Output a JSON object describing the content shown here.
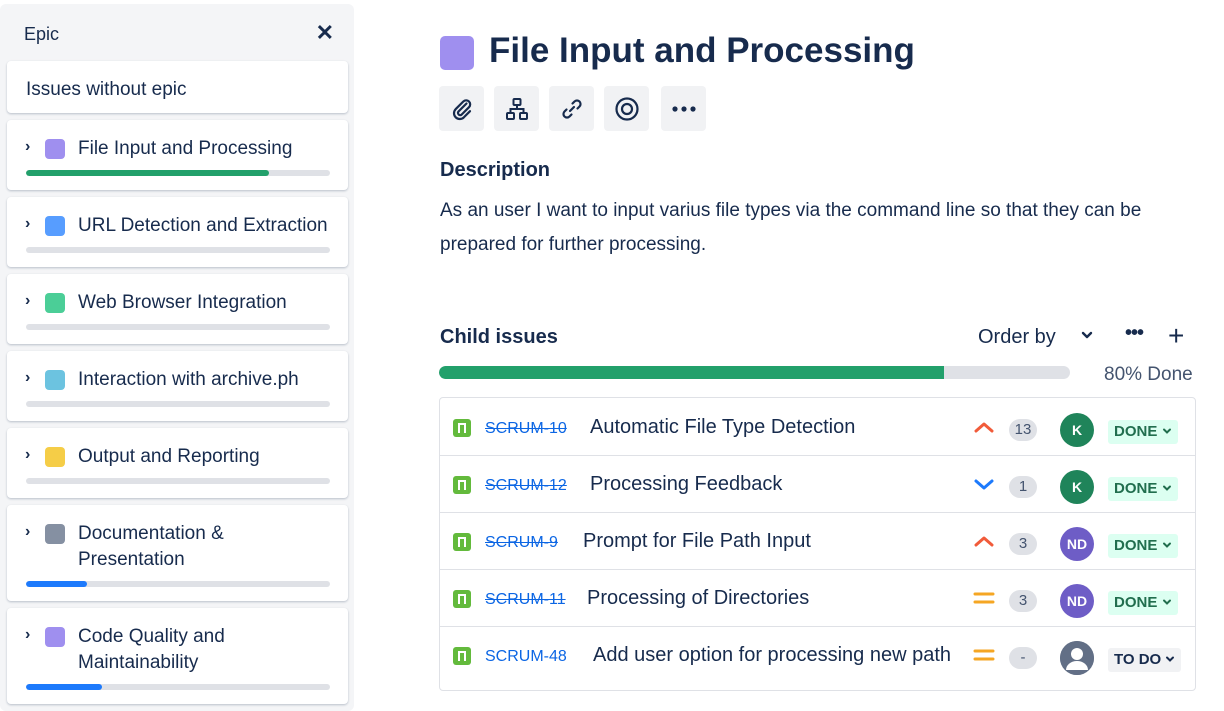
{
  "sidebar": {
    "title": "Epic",
    "close_icon": "close-icon",
    "issues_without_epic": "Issues without epic",
    "epics": [
      {
        "label": "File Input and Processing",
        "color": "#9f8fef",
        "progress_percent": 80,
        "progress_color": "#22a06b"
      },
      {
        "label": "URL Detection and Extraction",
        "color": "#579dff",
        "progress_percent": 0,
        "progress_color": "#22a06b"
      },
      {
        "label": "Web Browser Integration",
        "color": "#4bce97",
        "progress_percent": 0,
        "progress_color": "#22a06b"
      },
      {
        "label": "Interaction with archive.ph",
        "color": "#6cc3e0",
        "progress_percent": 0,
        "progress_color": "#22a06b"
      },
      {
        "label": "Output and Reporting",
        "color": "#f5cd47",
        "progress_percent": 0,
        "progress_color": "#22a06b"
      },
      {
        "label": "Documentation & Presentation",
        "color": "#8590a2",
        "progress_percent": 20,
        "progress_color": "#1d7afc"
      },
      {
        "label": "Code Quality and Maintainability",
        "color": "#9f8fef",
        "progress_percent": 25,
        "progress_color": "#1d7afc"
      }
    ]
  },
  "epic": {
    "title": "File Input and Processing",
    "color": "#9f8fef",
    "toolbar_icons": [
      "paperclip-icon",
      "hierarchy-icon",
      "link-icon",
      "target-icon",
      "more-icon"
    ],
    "description_label": "Description",
    "description": "As an user I want to input varius file types via the command line so that they can be prepared for further processing."
  },
  "child_issues": {
    "label": "Child issues",
    "order_by": "Order by",
    "progress_percent": 80,
    "progress_text": "80% Done",
    "items": [
      {
        "key": "SCRUM-10",
        "done": true,
        "summary": "Automatic File Type Detection",
        "priority": "high",
        "points": "13",
        "avatar": "K",
        "avatar_color": "#1f845a",
        "status": "DONE"
      },
      {
        "key": "SCRUM-12",
        "done": true,
        "summary": "Processing Feedback",
        "priority": "low",
        "points": "1",
        "avatar": "K",
        "avatar_color": "#1f845a",
        "status": "DONE"
      },
      {
        "key": "SCRUM-9",
        "done": true,
        "summary": "Prompt for File Path Input",
        "priority": "high",
        "points": "3",
        "avatar": "ND",
        "avatar_color": "#6e5dc6",
        "status": "DONE"
      },
      {
        "key": "SCRUM-11",
        "done": true,
        "summary": "Processing of Directories",
        "priority": "medium",
        "points": "3",
        "avatar": "ND",
        "avatar_color": "#6e5dc6",
        "status": "DONE"
      },
      {
        "key": "SCRUM-48",
        "done": false,
        "summary": "Add user option for processing new path",
        "priority": "medium",
        "points": "-",
        "avatar": "",
        "avatar_color": "#626f86",
        "status": "TO DO"
      }
    ]
  }
}
